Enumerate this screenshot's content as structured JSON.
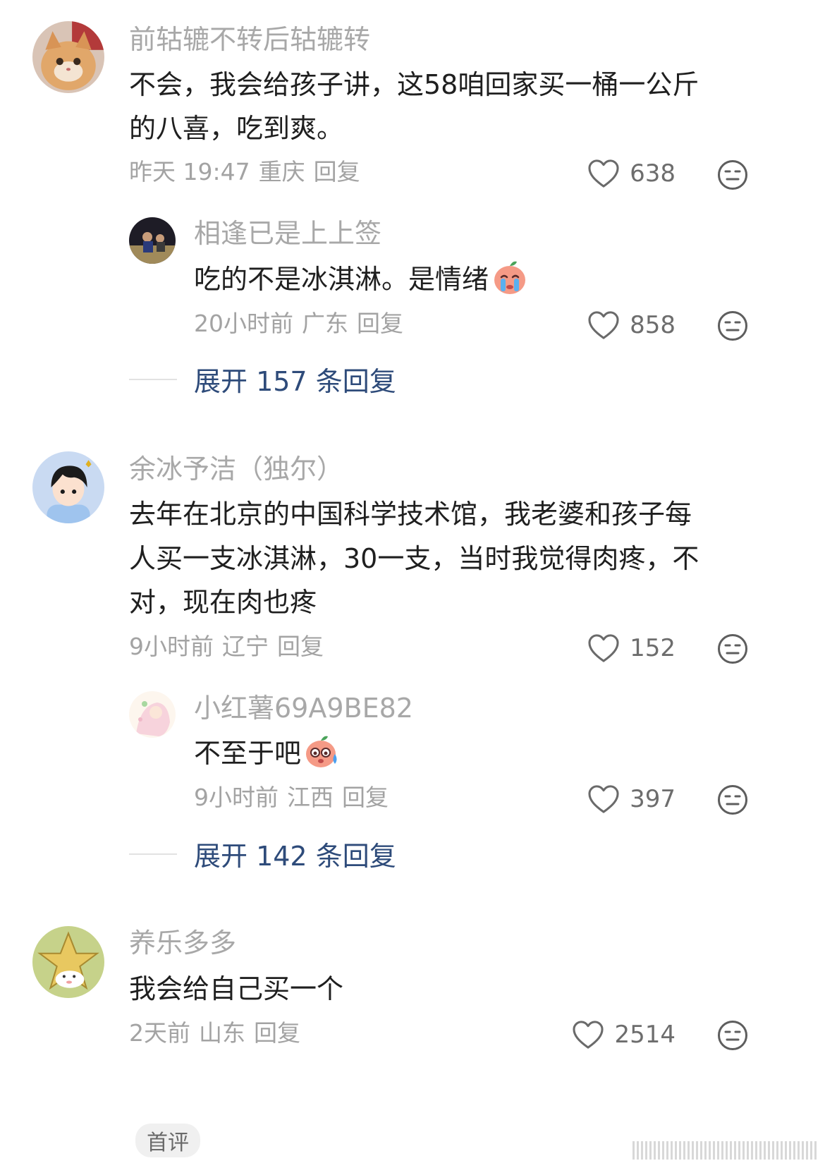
{
  "comments": [
    {
      "user": "前轱辘不转后轱辘转",
      "text_lines": [
        "不会，我会给孩子讲，这58咱回家买一桶一公斤",
        "的八喜，吃到爽。"
      ],
      "time": "昨天 19:47",
      "location": "重庆",
      "reply_label": "回复",
      "likes": "638",
      "replies": [
        {
          "user": "相逢已是上上签",
          "text": "吃的不是冰淇淋。是情绪",
          "emoji": "crying-peach-emoji",
          "time": "20小时前",
          "location": "广东",
          "reply_label": "回复",
          "likes": "858"
        }
      ],
      "expand_label": "展开 157 条回复"
    },
    {
      "user": "余冰予洁（独尔）",
      "text_lines": [
        "去年在北京的中国科学技术馆，我老婆和孩子每",
        "人买一支冰淇淋，30一支，当时我觉得肉疼，不",
        "对，现在肉也疼"
      ],
      "time": "9小时前",
      "location": "辽宁",
      "reply_label": "回复",
      "likes": "152",
      "replies": [
        {
          "user": "小红薯69A9BE82",
          "text": "不至于吧",
          "emoji": "sweating-peach-emoji",
          "time": "9小时前",
          "location": "江西",
          "reply_label": "回复",
          "likes": "397"
        }
      ],
      "expand_label": "展开 142 条回复"
    },
    {
      "user": "养乐多多",
      "text_lines": [
        "我会给自己买一个"
      ],
      "time": "2天前",
      "location": "山东",
      "reply_label": "回复",
      "likes": "2514",
      "badge": "首评"
    }
  ],
  "icons": {
    "like": "heart-outline-icon",
    "dislike": "meh-face-icon"
  },
  "colors": {
    "username": "#a8a8a8",
    "text": "#1f1f1f",
    "meta": "#a3a3a3",
    "expand_link": "#2e4b7a",
    "badge_bg": "#f0f0f0"
  }
}
